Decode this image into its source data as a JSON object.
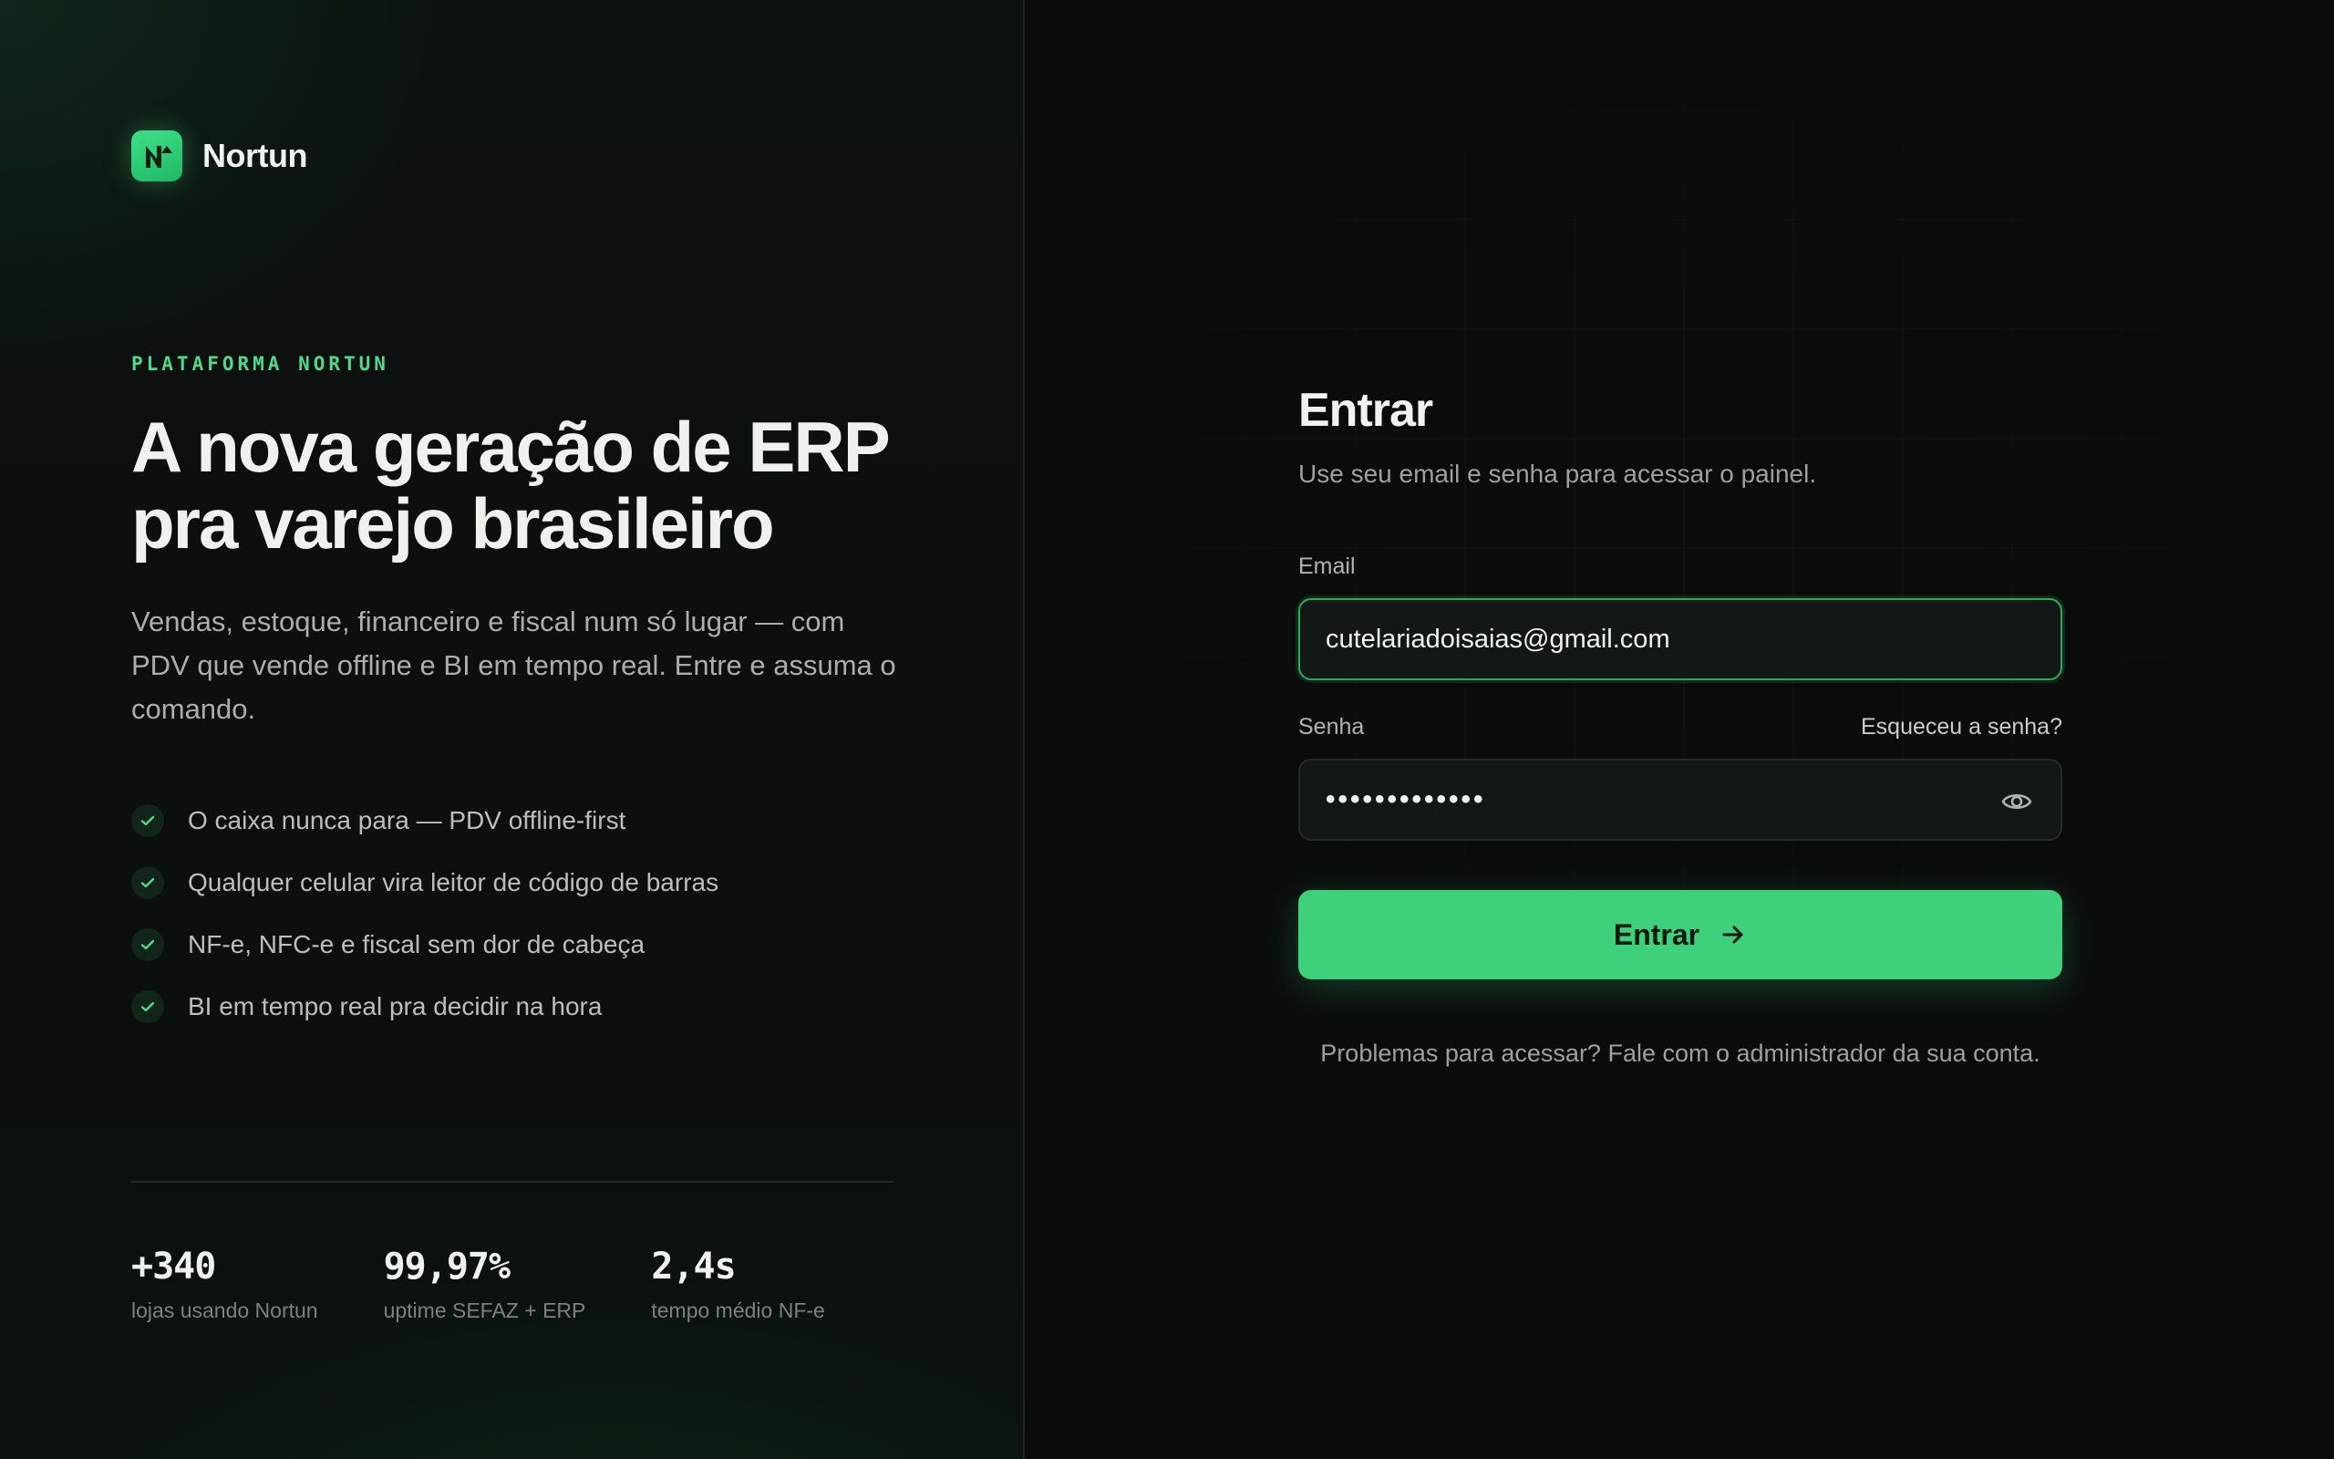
{
  "brand": {
    "name": "Nortun",
    "accent": "#3ed07a"
  },
  "hero": {
    "eyebrow": "PLATAFORMA NORTUN",
    "headline_line1": "A nova geração de ERP",
    "headline_line2": "pra varejo brasileiro",
    "lead": "Vendas, estoque, financeiro e fiscal num só lugar — com PDV que vende offline e BI em tempo real. Entre e assuma o comando."
  },
  "features": [
    {
      "icon": "check-icon",
      "text": "O caixa nunca para — PDV offline-first"
    },
    {
      "icon": "check-icon",
      "text": "Qualquer celular vira leitor de código de barras"
    },
    {
      "icon": "check-icon",
      "text": "NF-e, NFC-e e fiscal sem dor de cabeça"
    },
    {
      "icon": "check-icon",
      "text": "BI em tempo real pra decidir na hora"
    }
  ],
  "stats": [
    {
      "value": "+340",
      "label": "lojas usando Nortun"
    },
    {
      "value": "99,97%",
      "label": "uptime SEFAZ + ERP"
    },
    {
      "value": "2,4s",
      "label": "tempo médio NF-e"
    }
  ],
  "login": {
    "title": "Entrar",
    "subtitle": "Use seu email e senha para acessar o painel.",
    "email_label": "Email",
    "email_value": "cutelariadoisaias@gmail.com",
    "password_label": "Senha",
    "forgot_label": "Esqueceu a senha?",
    "password_mask": "•••••••••••••",
    "submit_label": "Entrar",
    "help_text": "Problemas para acessar? Fale com o administrador da sua conta."
  }
}
